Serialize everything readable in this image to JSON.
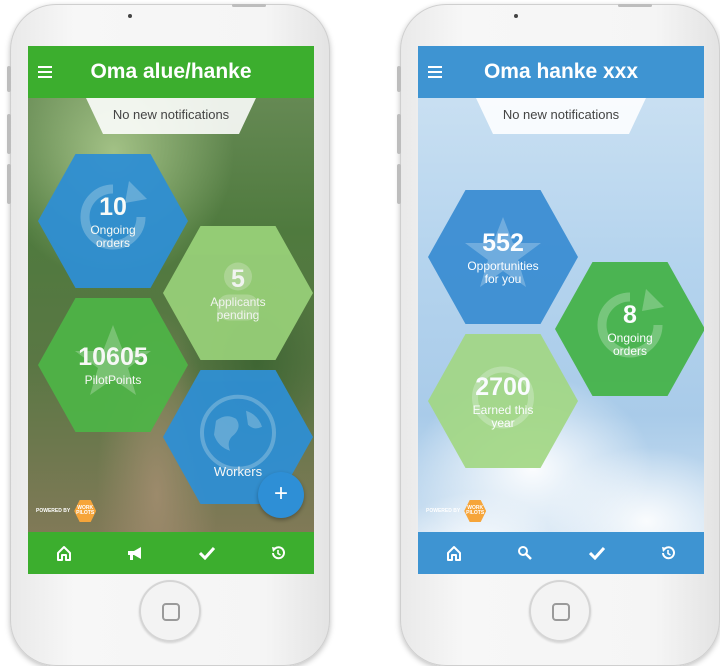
{
  "phones": {
    "left": {
      "title": "Oma alue/hanke",
      "notification": "No new notifications",
      "tiles": {
        "ongoing": {
          "number": "10",
          "label": "Ongoing orders"
        },
        "applicants": {
          "number": "5",
          "label": "Applicants pending"
        },
        "pilotpoints": {
          "number": "10605",
          "label": "PilotPoints"
        },
        "workers": {
          "label": "Workers"
        }
      },
      "fab_label": "+",
      "nav": [
        "home-icon",
        "megaphone-icon",
        "check-icon",
        "history-icon"
      ],
      "colors": {
        "bar": "#3cae2e",
        "blue_tile": "#2f8fd3",
        "green_tile": "#4fb447",
        "light_tile": "#9ad27a"
      }
    },
    "right": {
      "title": "Oma hanke xxx",
      "notification": "No new notifications",
      "tiles": {
        "opportunities": {
          "number": "552",
          "label": "Opportunities for you"
        },
        "ongoing": {
          "number": "8",
          "label": "Ongoing orders"
        },
        "earned": {
          "number": "2700",
          "label": "Earned this year"
        }
      },
      "nav": [
        "home-icon",
        "search-icon",
        "check-icon",
        "history-icon"
      ],
      "colors": {
        "bar": "#3e94d2",
        "blue_tile": "#3b8ed2",
        "green_tile": "#46b34a",
        "light_tile": "#a2d784"
      }
    }
  },
  "logo": {
    "small_text": "POWERED BY",
    "badge_text": "WORK PILOTS"
  }
}
